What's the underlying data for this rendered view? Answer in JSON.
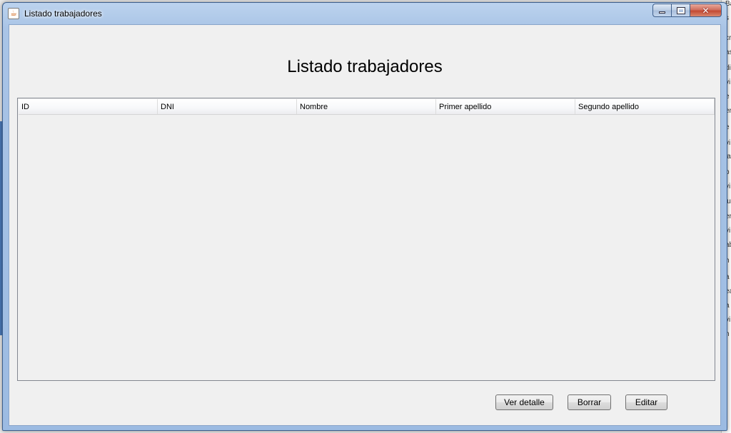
{
  "window": {
    "title": "Listado trabajadores",
    "icon": "java-cup-icon"
  },
  "heading": "Listado trabajadores",
  "table": {
    "columns": [
      "ID",
      "DNI",
      "Nombre",
      "Primer apellido",
      "Segundo apellido"
    ],
    "rows": []
  },
  "buttons": {
    "detail": "Ver detalle",
    "delete": "Borrar",
    "edit": "Editar"
  },
  "background_fragments": [
    "Ba",
    "s",
    "cr",
    "as",
    "di",
    "vi",
    "e",
    "er",
    "e",
    "vi",
    "ia",
    "p",
    "vi",
    "lu",
    "er",
    "vi",
    "ab",
    "h",
    "a",
    "ea",
    "a",
    "vi",
    "h"
  ],
  "colors": {
    "title_bar": "#a9c4e6",
    "client_bg": "#f0f0f0",
    "close_button": "#c34a33"
  }
}
